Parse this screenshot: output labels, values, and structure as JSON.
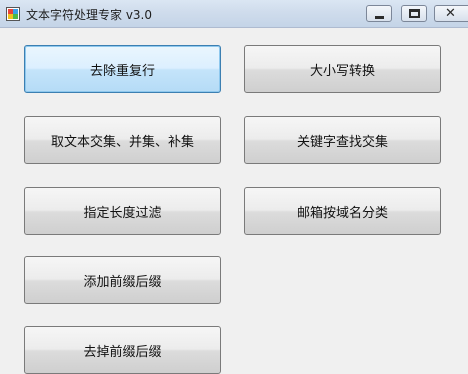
{
  "window": {
    "title": "文本字符处理专家 v3.0"
  },
  "buttons": {
    "dedupe": "去除重复行",
    "case_convert": "大小写转换",
    "set_ops": "取文本交集、并集、补集",
    "keyword_intersect": "关键字查找交集",
    "length_filter": "指定长度过滤",
    "email_domain": "邮箱按域名分类",
    "add_prefix_suffix": "添加前缀后缀",
    "remove_prefix_suffix": "去掉前缀后缀"
  },
  "colors": {
    "focus_border": "#3c7fb1",
    "titlebar": "#cfdcec"
  }
}
